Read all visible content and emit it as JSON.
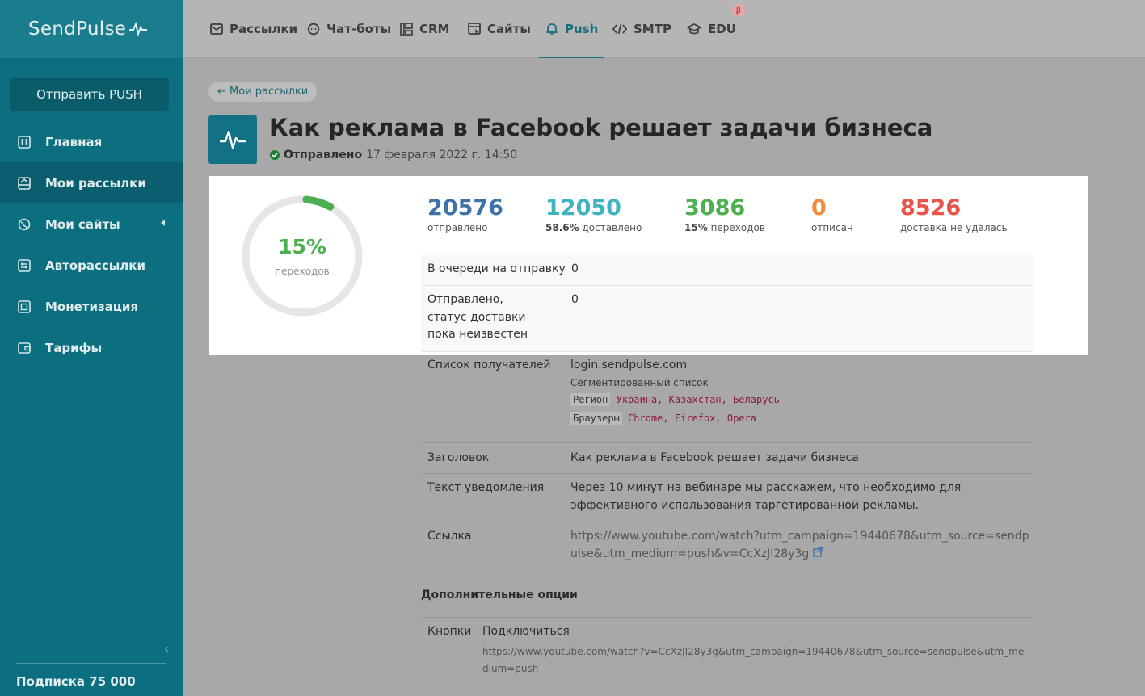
{
  "sidebar": {
    "logo": "SendPulse",
    "send_button": "Отправить PUSH",
    "items": [
      {
        "label": "Главная"
      },
      {
        "label": "Мои рассылки"
      },
      {
        "label": "Мои сайты"
      },
      {
        "label": "Авторассылки"
      },
      {
        "label": "Монетизация"
      },
      {
        "label": "Тарифы"
      }
    ],
    "subscription": "Подписка 75 000"
  },
  "topnav": {
    "tabs": [
      {
        "label": "Рассылки",
        "icon": "mail-icon"
      },
      {
        "label": "Чат-боты",
        "icon": "chat-icon"
      },
      {
        "label": "CRM",
        "icon": "crm-icon"
      },
      {
        "label": "Сайты",
        "icon": "site-icon"
      },
      {
        "label": "Push",
        "icon": "bell-icon"
      },
      {
        "label": "SMTP",
        "icon": "code-icon"
      },
      {
        "label": "EDU",
        "icon": "graduation-cap-icon"
      }
    ],
    "active_tab": "Push",
    "beta_badge": "β"
  },
  "page": {
    "back_link": "← Мои рассылки",
    "title": "Как реклама в Facebook решает задачи бизнеса",
    "status_label": "Отправлено",
    "status_date": "17 февраля 2022 г. 14:50"
  },
  "gauge": {
    "value": "15%",
    "label": "переходов",
    "fraction": 0.15
  },
  "stats": [
    {
      "num": "20576",
      "pct": "",
      "label": "отправлено",
      "color": "#3f73a8"
    },
    {
      "num": "12050",
      "pct": "58.6%",
      "label": "доставлено",
      "color": "#3fb4bf"
    },
    {
      "num": "3086",
      "pct": "15%",
      "label": "переходов",
      "color": "#4caf50"
    },
    {
      "num": "0",
      "pct": "",
      "label": "отписан",
      "color": "#f08a3c"
    },
    {
      "num": "8526",
      "pct": "",
      "label": "доставка не удалась",
      "color": "#e8534a"
    }
  ],
  "queue": [
    {
      "key": "В очереди на отправку",
      "value": "0"
    },
    {
      "key": "Отправлено, статус доставки пока неизвестен",
      "value": "0"
    }
  ],
  "details": {
    "recipients_key": "Список получателей",
    "recipients_site": "login.sendpulse.com",
    "segmented": "Сегментированный список",
    "region_chip": "Регион",
    "region_values": "Украина, Казахстан, Беларусь",
    "browser_chip": "Браузеры",
    "browser_values": "Chrome, Firefox, Opera",
    "title_key": "Заголовок",
    "title_value": "Как реклама в Facebook решает задачи бизнеса",
    "text_key": "Текст уведомления",
    "text_value": "Через 10 минут на вебинаре мы расскажем, что необходимо для эффективного использования таргетированной рекламы.",
    "link_key": "Ссылка",
    "link_value": "https://www.youtube.com/watch?utm_campaign=19440678&utm_source=sendpulse&utm_medium=push&v=CcXzJI28y3g"
  },
  "options": {
    "heading": "Дополнительные опции",
    "buttons_key": "Кнопки",
    "button_label": "Подключиться",
    "button_url": "https://www.youtube.com/watch?v=CcXzJI28y3g&utm_campaign=19440678&utm_source=sendpulse&utm_medium=push"
  }
}
